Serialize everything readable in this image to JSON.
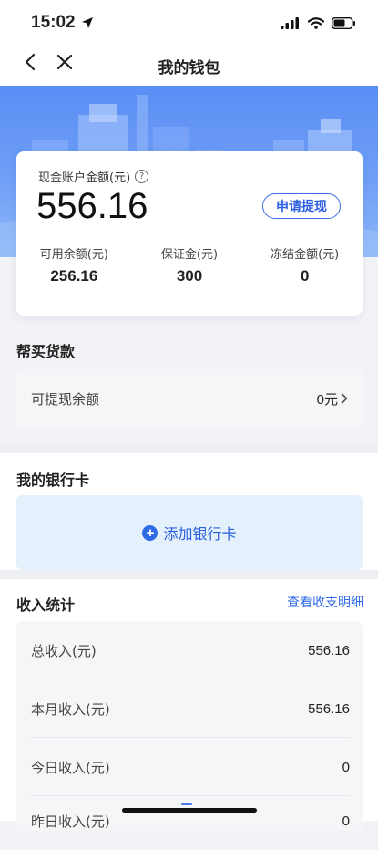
{
  "status_bar": {
    "time": "15:02"
  },
  "nav": {
    "title": "我的钱包"
  },
  "wallet": {
    "cash_label": "现金账户金额(元)",
    "help_glyph": "?",
    "cash_amount": "556.16",
    "withdraw_label": "申请提现",
    "stats": [
      {
        "label": "可用余额(元)",
        "value": "256.16"
      },
      {
        "label": "保证金(元)",
        "value": "300"
      },
      {
        "label": "冻结金额(元)",
        "value": "0"
      }
    ]
  },
  "purchase": {
    "title": "帮买货款",
    "row_label": "可提现余额",
    "row_value": "0元"
  },
  "bank": {
    "title": "我的银行卡",
    "add_label": "添加银行卡"
  },
  "income": {
    "title": "收入统计",
    "link_label": "查看收支明细",
    "rows": [
      {
        "label": "总收入(元)",
        "value": "556.16"
      },
      {
        "label": "本月收入(元)",
        "value": "556.16"
      },
      {
        "label": "今日收入(元)",
        "value": "0"
      },
      {
        "label": "昨日收入(元)",
        "value": "0"
      }
    ]
  },
  "colors": {
    "accent": "#2f6ae6",
    "hero_top": "#5b8ef5",
    "page_bg": "#f2f3f6"
  },
  "icons": [
    "location-arrow-icon",
    "signal-icon",
    "wifi-icon",
    "battery-icon",
    "back-icon",
    "close-icon",
    "help-icon",
    "plus-icon",
    "chevron-right-icon"
  ]
}
